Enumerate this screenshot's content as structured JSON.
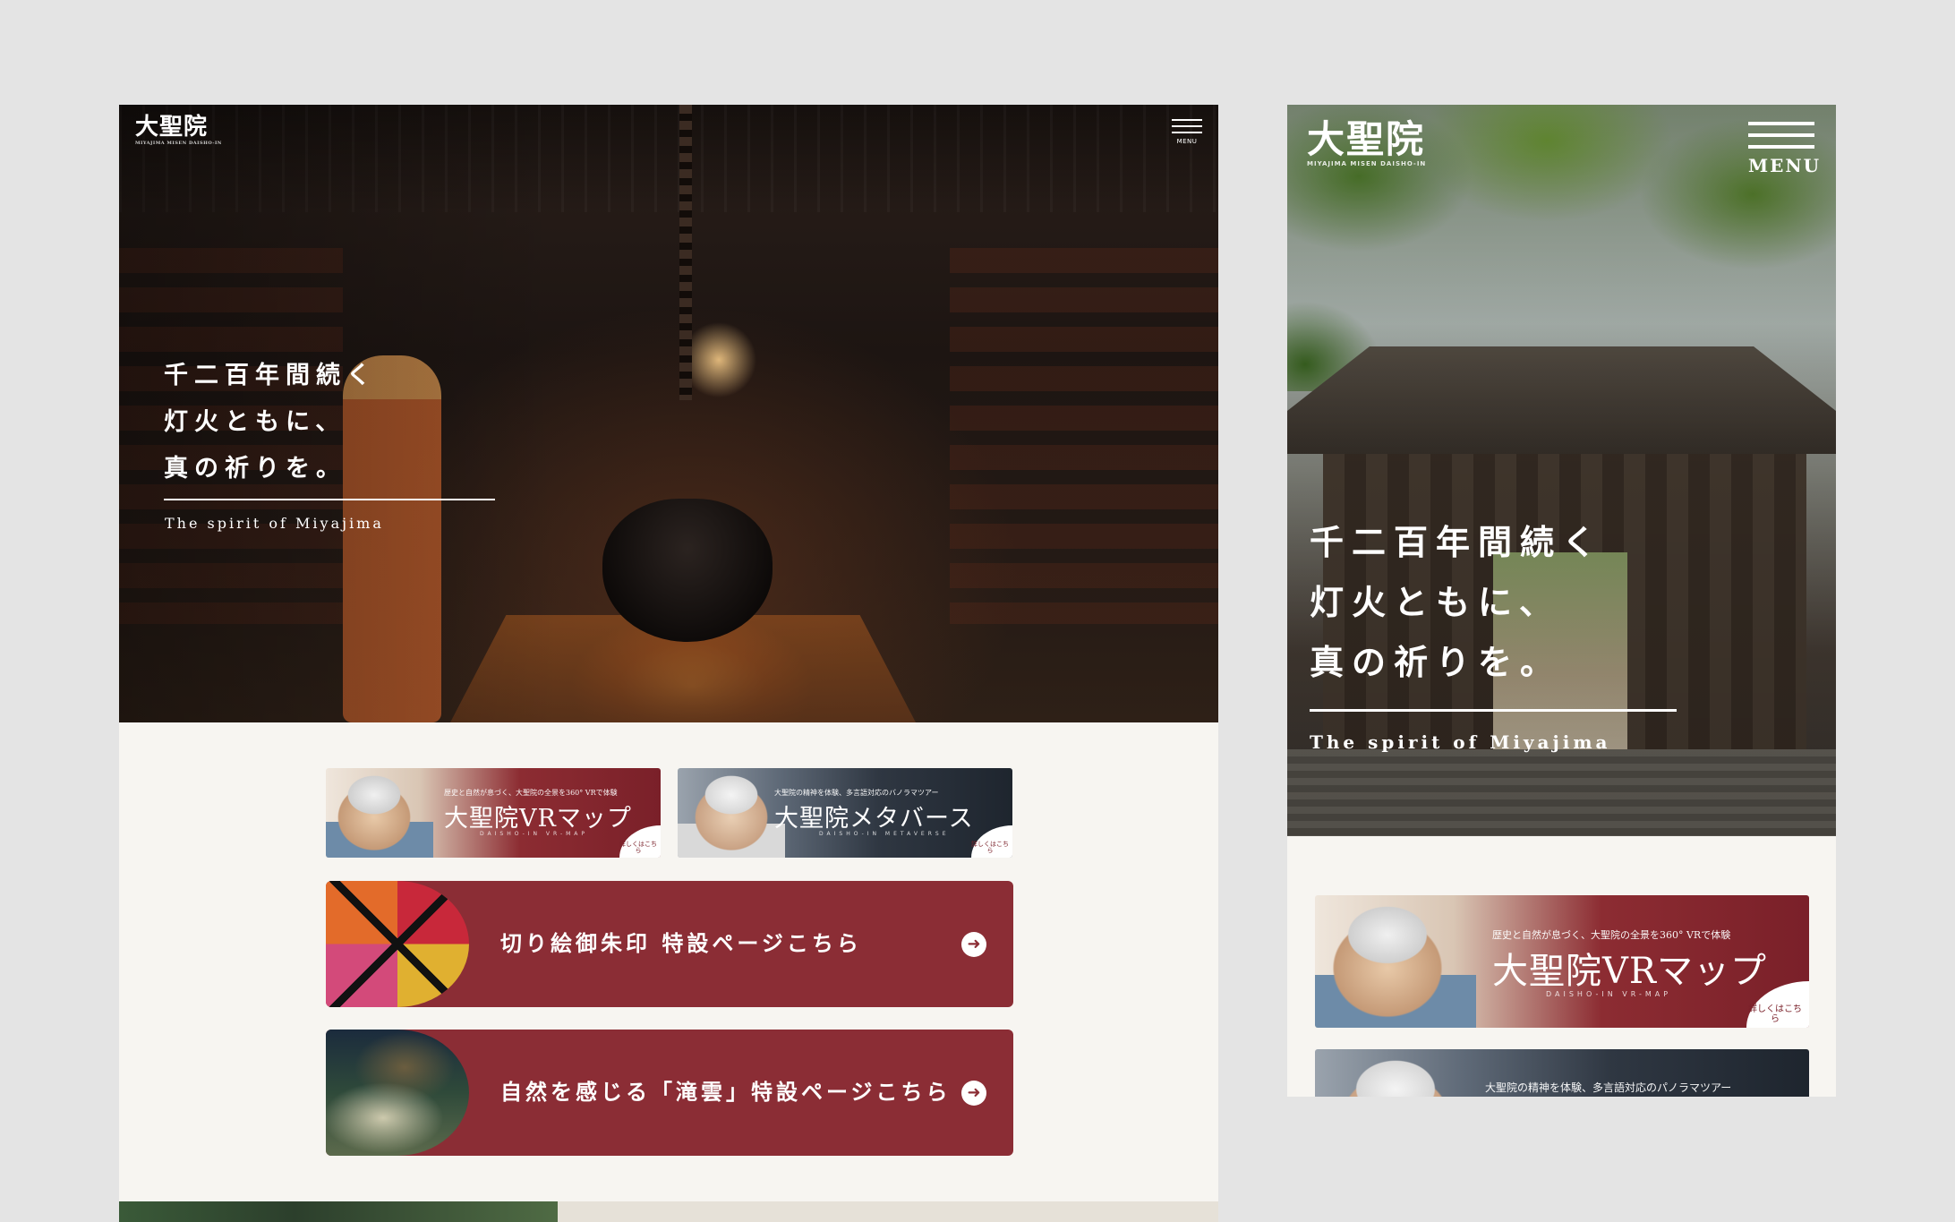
{
  "site": {
    "logo_mark": "大聖院",
    "logo_sub": "MIYAJIMA MISEN DAISHO-IN",
    "menu_label": "MENU",
    "catch_lines": [
      "千二百年間続く",
      "灯火ともに、",
      "真の祈りを。"
    ],
    "tagline": "The spirit of Miyajima"
  },
  "desktop": {
    "banners": [
      {
        "tagline": "歴史と自然が息づく、大聖院の全景を360° VRで体験",
        "title": "大聖院VRマップ",
        "roman": "DAISHO-IN VR-MAP",
        "corner": "詳しくはこちら"
      },
      {
        "tagline": "大聖院の精神を体験、多言語対応のバノラマツアー",
        "title": "大聖院メタバース",
        "roman": "DAISHO-IN METAVERSE",
        "corner": "詳しくはこちら"
      }
    ],
    "cta": [
      {
        "label": "切り絵御朱印 特設ページこちら",
        "arrow": "➜"
      },
      {
        "label": "自然を感じる「滝雲」特設ページこちら",
        "arrow": "➜"
      }
    ]
  },
  "mobile": {
    "banners": [
      {
        "tagline": "歴史と自然が息づく、大聖院の全景を360° VRで体験",
        "title": "大聖院VRマップ",
        "roman": "DAISHO-IN VR-MAP",
        "corner": "詳しくはこちら"
      },
      {
        "tagline": "大聖院の精神を体験、多言語対応のパノラマツアー"
      }
    ]
  },
  "colors": {
    "accent": "#8b2d35",
    "background": "#e4e4e4",
    "page": "#f7f5f1"
  },
  "icons": {
    "menu": "hamburger-icon",
    "arrow": "arrow-right-circle-icon"
  }
}
